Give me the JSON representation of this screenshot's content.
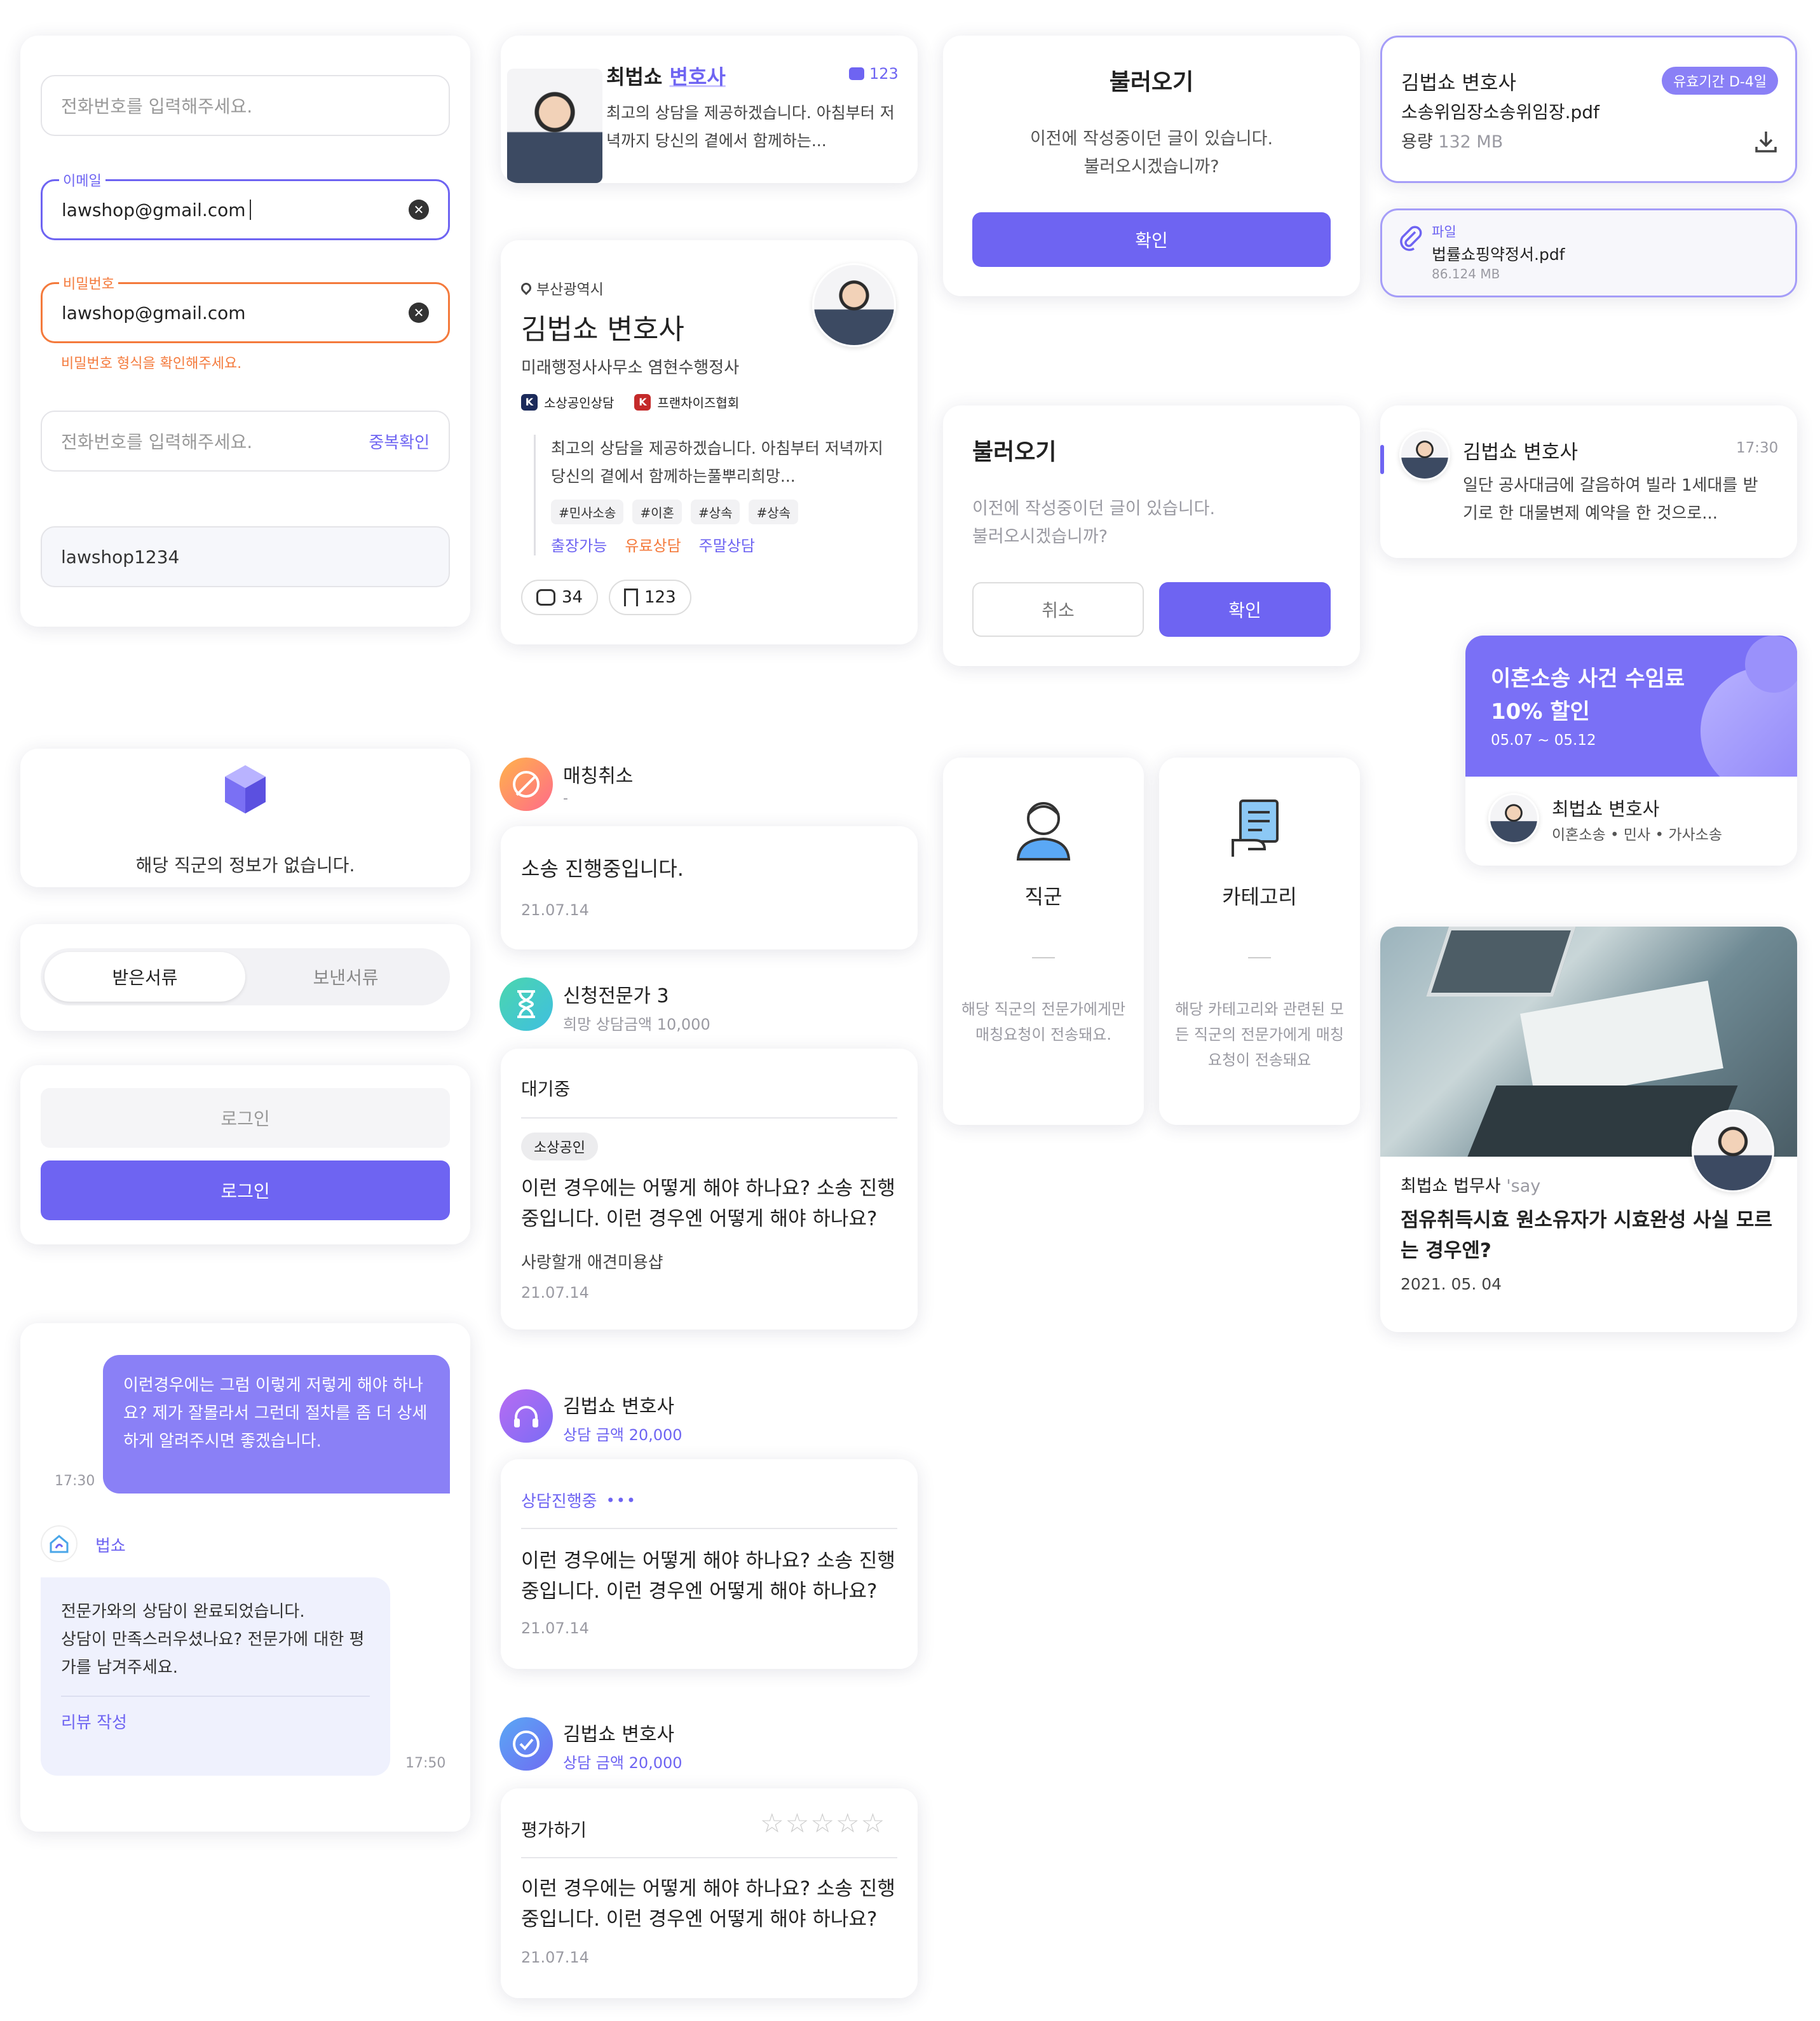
{
  "forms": {
    "phone_placeholder": "전화번호를 입력해주세요.",
    "email_label": "이메일",
    "email_value": "lawshop@gmail.com",
    "password_label": "비밀번호",
    "password_value": "lawshop@gmail.com",
    "password_error": "비밀번호 형식을 확인해주세요.",
    "phone2_placeholder": "전화번호를 입력해주세요.",
    "dup_check": "중복확인",
    "id_value": "lawshop1234"
  },
  "lawyer_small": {
    "name": "최법쇼",
    "title": "변호사",
    "comments": "123",
    "desc": "최고의 상담을 제공하겠습니다. 아침부터 저녁까지 당신의 곁에서 함께하는..."
  },
  "lawyer_profile": {
    "location": "부산광역시",
    "name": "김법쇼 변호사",
    "office": "미래행정사사무소 염현수행정사",
    "badge1_letter": "K",
    "badge1": "소상공인상담",
    "badge2_letter": "K",
    "badge2": "프랜차이즈협회",
    "desc": "최고의 상담을 제공하겠습니다. 아침부터 저녁까지 당신의 곁에서 함께하는풀뿌리희망...",
    "tags": [
      "#민사소송",
      "#이혼",
      "#상속",
      "#상속"
    ],
    "options": [
      "출장가능",
      "유료상담",
      "주말상담"
    ],
    "comments": "34",
    "bookmarks": "123"
  },
  "dialog1": {
    "title": "불러오기",
    "message_1": "이전에 작성중이던 글이 있습니다.",
    "message_2": "불러오시겠습니까?",
    "confirm": "확인"
  },
  "dialog2": {
    "title": "불러오기",
    "message_1": "이전에 작성중이던 글이 있습니다.",
    "message_2": "불러오시겠습니까?",
    "cancel": "취소",
    "confirm": "확인"
  },
  "file_card": {
    "name": "김법쇼 변호사",
    "badge": "유효기간 D-4일",
    "file": "소송위임장소송위임장.pdf",
    "size_label": "용량",
    "size": "132 MB"
  },
  "attachment": {
    "label": "파일",
    "file": "법률쇼핑약정서.pdf",
    "size": "86.124 MB"
  },
  "message_item": {
    "name": "김법쇼 변호사",
    "time": "17:30",
    "text": "일단 공사대금에 갈음하여 빌라 1세대를 받기로 한 대물변제 예약을 한 것으로..."
  },
  "promo": {
    "title": "이혼소송 사건 수임료",
    "discount": "10% 할인",
    "period": "05.07 ~ 05.12",
    "lawyer": "최법쇼 변호사",
    "fields": "이혼소송 • 민사 • 가사소송"
  },
  "empty_state": {
    "text": "해당 직군의 정보가 없습니다."
  },
  "doc_tabs": {
    "received": "받은서류",
    "sent": "보낸서류"
  },
  "login": {
    "disabled": "로그인",
    "enabled": "로그인"
  },
  "chat": {
    "user_msg": "이런경우에는 그럼 이렇게 저렇게 해야 하나요? 제가 잘몰라서 그런데 절차를 좀 더 상세하게 알려주시면 좋겠습니다.",
    "user_time": "17:30",
    "bot_name": "법쇼",
    "bot_msg_1": "전문가와의 상담이 완료되었습니다.",
    "bot_msg_2": "상담이 만족스러우셨나요? 전문가에 대한 평가를 남겨주세요.",
    "review_link": "리뷰 작성",
    "bot_time": "17:50"
  },
  "history": {
    "cancel_title": "매칭취소",
    "cancel_sub": "-",
    "cancel_card_text": "소송 진행중입니다.",
    "cancel_card_date": "21.07.14",
    "apply_title": "신청전문가 3",
    "apply_sub": "희망 상담금액 10,000",
    "apply_status": "대기중",
    "apply_tag": "소상공인",
    "apply_question": "이런 경우에는 어떻게 해야 하나요? 소송 진행중입니다. 이런 경우엔 어떻게 해야 하나요?",
    "apply_author": "사랑할개 애견미용샵",
    "apply_date": "21.07.14",
    "consult_name": "김법쇼 변호사",
    "consult_fee": "상담 금액 20,000",
    "consult_status": "상담진행중",
    "consult_question": "이런 경우에는 어떻게 해야 하나요? 소송 진행중입니다. 이런 경우엔 어떻게 해야 하나요?",
    "consult_date": "21.07.14",
    "done_name": "김법쇼 변호사",
    "done_fee": "상담 금액 20,000",
    "rate_label": "평가하기",
    "done_question": "이런 경우에는 어떻게 해야 하나요? 소송 진행중입니다. 이런 경우엔 어떻게 해야 하나요?",
    "done_date": "21.07.14"
  },
  "select_cards": {
    "job_title": "직군",
    "job_desc": "해당 직군의 전문가에게만 매칭요청이 전송돼요.",
    "cat_title": "카테고리",
    "cat_desc": "해당 카테고리와 관련된 모든 직군의 전문가에게 매칭요청이 전송돼요"
  },
  "article": {
    "author": "최법쇼 법무사",
    "say": "'say",
    "title": "점유취득시효 원소유자가 시효완성 사실 모르는 경우엔?",
    "date": "2021. 05. 04"
  },
  "colors": {
    "primary": "#6e64f2",
    "error": "#f47a3c",
    "text": "#222222",
    "muted": "#9a9aa2"
  }
}
